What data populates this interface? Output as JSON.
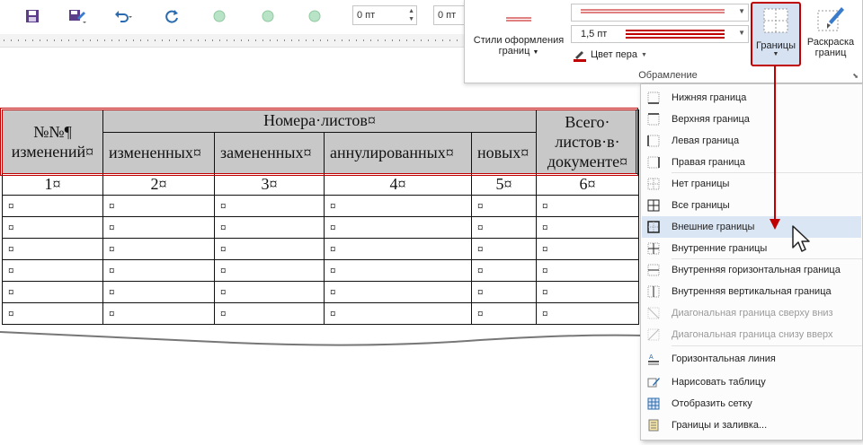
{
  "toolbar": {
    "save_icon": "save-icon",
    "save_as_icon": "save-as-icon",
    "undo_icon": "undo-icon",
    "redo_icon": "redo-icon",
    "spacing_before": "0 пт",
    "spacing_after": "0 пт"
  },
  "ribbon": {
    "border_styles_label_line1": "Стили оформления",
    "border_styles_label_line2": "границ",
    "pen_weight": "1,5 пт",
    "pen_color_label": "Цвет пера",
    "borders_button": "Границы",
    "border_painter_line1": "Раскраска",
    "border_painter_line2": "границ",
    "group_label": "Обрамление"
  },
  "table": {
    "header_no_line1": "№№¶",
    "header_no_line2": "изменений¤",
    "header_sheets": "Номера·листов¤",
    "header_total_line1": "Всего·",
    "header_total_line2": "листов·в·",
    "header_total_line3": "документе¤",
    "sub_changed": "измененных¤",
    "sub_replaced": "замененных¤",
    "sub_cancelled": "аннулированных¤",
    "sub_new": "новых¤",
    "numbers": [
      "1¤",
      "2¤",
      "3¤",
      "4¤",
      "5¤",
      "6¤"
    ],
    "empty_cell": "¤"
  },
  "menu": {
    "items": [
      {
        "label": "Нижняя граница",
        "icon": "bottom-border-icon",
        "state": "normal"
      },
      {
        "label": "Верхняя граница",
        "icon": "top-border-icon",
        "state": "normal"
      },
      {
        "label": "Левая граница",
        "icon": "left-border-icon",
        "state": "normal"
      },
      {
        "label": "Правая граница",
        "icon": "right-border-icon",
        "state": "normal"
      },
      {
        "label": "Нет границы",
        "icon": "no-border-icon",
        "state": "normal"
      },
      {
        "label": "Все границы",
        "icon": "all-borders-icon",
        "state": "normal"
      },
      {
        "label": "Внешние границы",
        "icon": "outside-borders-icon",
        "state": "highlighted"
      },
      {
        "label": "Внутренние границы",
        "icon": "inside-borders-icon",
        "state": "normal"
      },
      {
        "label": "Внутренняя горизонтальная граница",
        "icon": "inside-horizontal-border-icon",
        "state": "normal"
      },
      {
        "label": "Внутренняя вертикальная граница",
        "icon": "inside-vertical-border-icon",
        "state": "normal"
      },
      {
        "label": "Диагональная граница сверху вниз",
        "icon": "diagonal-down-border-icon",
        "state": "disabled"
      },
      {
        "label": "Диагональная граница снизу вверх",
        "icon": "diagonal-up-border-icon",
        "state": "disabled"
      },
      {
        "label": "Горизонтальная линия",
        "icon": "horizontal-line-icon",
        "state": "normal"
      },
      {
        "label": "Нарисовать таблицу",
        "icon": "draw-table-icon",
        "state": "normal"
      },
      {
        "label": "Отобразить сетку",
        "icon": "view-gridlines-icon",
        "state": "normal"
      },
      {
        "label": "Границы и заливка...",
        "icon": "borders-shading-icon",
        "state": "normal"
      }
    ]
  },
  "colors": {
    "accent_red": "#c00000",
    "highlight": "#dbe6f4",
    "header_fill": "#c8c8c8"
  }
}
